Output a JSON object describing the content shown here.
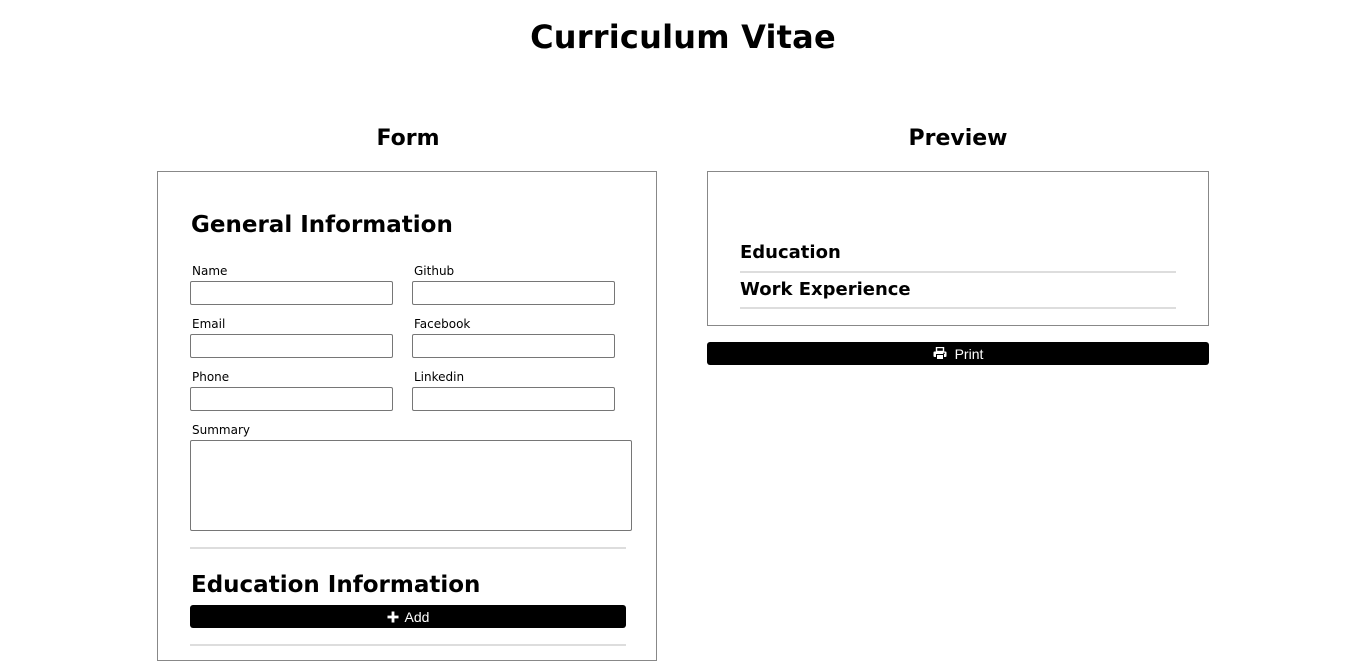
{
  "page": {
    "title": "Curriculum Vitae"
  },
  "form": {
    "title": "Form",
    "general": {
      "heading": "General Information",
      "fields": {
        "name": {
          "label": "Name",
          "value": ""
        },
        "github": {
          "label": "Github",
          "value": ""
        },
        "email": {
          "label": "Email",
          "value": ""
        },
        "facebook": {
          "label": "Facebook",
          "value": ""
        },
        "phone": {
          "label": "Phone",
          "value": ""
        },
        "linkedin": {
          "label": "Linkedin",
          "value": ""
        },
        "summary": {
          "label": "Summary",
          "value": ""
        }
      }
    },
    "education": {
      "heading": "Education Information",
      "add_label": "Add",
      "add_icon": "plus-icon"
    }
  },
  "preview": {
    "title": "Preview",
    "sections": [
      "Education",
      "Work Experience"
    ],
    "print_label": "Print",
    "print_icon": "printer-icon"
  },
  "colors": {
    "button_bg": "#000000",
    "button_text": "#ffffff",
    "panel_border": "#888888",
    "divider": "#dddddd"
  }
}
